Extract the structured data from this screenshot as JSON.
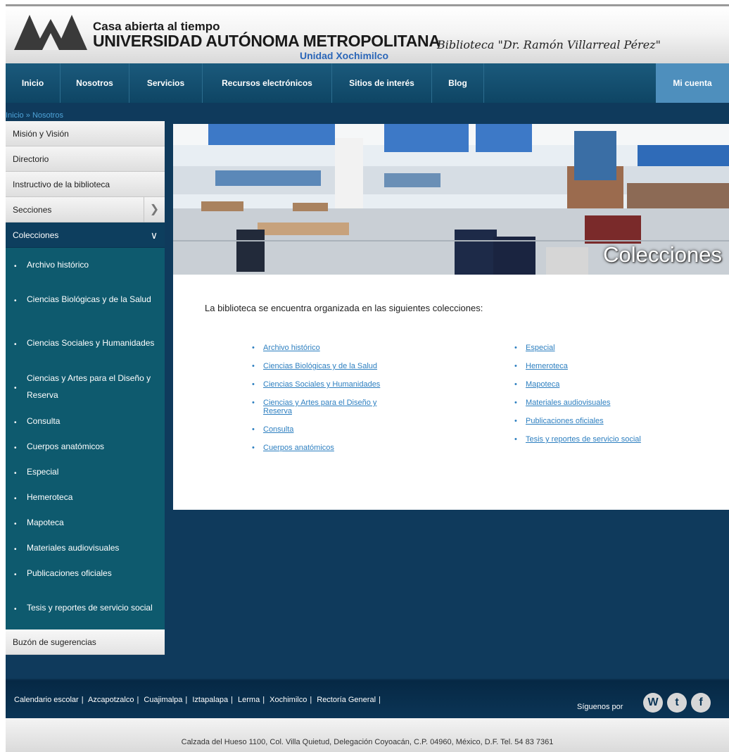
{
  "header": {
    "tagline": "Casa abierta al tiempo",
    "university": "UNIVERSIDAD AUTÓNOMA METROPOLITANA",
    "unit": "Unidad Xochimilco",
    "library": "Biblioteca \"Dr. Ramón Villarreal Pérez\""
  },
  "nav": {
    "items": [
      "Inicio",
      "Nosotros",
      "Servicios",
      "Recursos electrónicos",
      "Sitios de interés",
      "Blog"
    ],
    "account": "Mi cuenta"
  },
  "breadcrumb": {
    "home": "Inicio",
    "sep": "»",
    "current": "Nosotros"
  },
  "sidebar": {
    "items": [
      "Misión y Visión",
      "Directorio",
      "Instructivo de la biblioteca",
      "Secciones",
      "Colecciones"
    ],
    "collections": [
      "Archivo histórico",
      "Ciencias Biológicas y de la Salud",
      "Ciencias Sociales y Humanidades",
      "Ciencias y Artes para el Diseño y Reserva",
      "Consulta",
      "Cuerpos anatómicos",
      "Especial",
      "Hemeroteca",
      "Mapoteca",
      "Materiales audiovisuales",
      "Publicaciones oficiales",
      "Tesis y reportes de servicio social"
    ],
    "suggestions": "Buzón de sugerencias"
  },
  "banner": {
    "title": "Colecciones"
  },
  "main": {
    "intro": "La biblioteca se encuentra organizada en las siguientes colecciones:",
    "left": [
      "Archivo histórico",
      "Ciencias Biológicas y de la Salud",
      "Ciencias Sociales y Humanidades",
      "Ciencias y Artes para el Diseño y Reserva",
      "Consulta",
      "Cuerpos anatómicos"
    ],
    "right": [
      "Especial",
      "Hemeroteca",
      "Mapoteca",
      "Materiales audiovisuales",
      "Publicaciones oficiales",
      "Tesis y reportes de servicio social"
    ]
  },
  "footer": {
    "links": [
      "Calendario escolar",
      "Azcapotzalco",
      "Cuajimalpa",
      "Iztapalapa",
      "Lerma",
      "Xochimilco",
      "Rectoría General"
    ],
    "follow": "Síguenos por",
    "social": [
      "wordpress-icon",
      "twitter-icon",
      "facebook-icon"
    ],
    "address": "Calzada del Hueso 1100, Col. Villa Quietud, Delegación Coyoacán, C.P. 04960, México, D.F. Tel. 54 83 7361"
  },
  "colors": {
    "nav": "#0e4564",
    "accent": "#4e8fbd",
    "sidebar_sub": "#0e5a6e",
    "page_bg": "#0f3a5c",
    "link": "#2d7fc0"
  }
}
